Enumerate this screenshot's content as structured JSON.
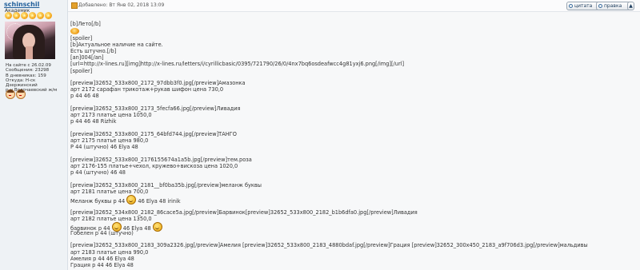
{
  "user": {
    "name": "schinschil",
    "rank": "Академик",
    "info": [
      "На сайте с 26.02.09",
      "Сообщения: 23298",
      "В дневниках: 159",
      "Откуда: Н-ск Дзержинский",
      "р-н Волочаевский ж/м"
    ],
    "star_icon": "sun-star-icon",
    "avatar_icon": "avatar-portrait"
  },
  "postbar": {
    "date": "Добавлено: Вт Янв 02, 2018 13:09",
    "quote_label": "цитата",
    "edit_label": "правка",
    "up_label": "▲"
  },
  "post_lines": {
    "l1": "[b]Лето[/b]",
    "l3": "[spoiler]",
    "l4": "[b]Актуальное наличие на сайте.",
    "l5": "Есть штучно.[/b]",
    "l6": "[an]004[/an]",
    "l7": "[url=http://x-lines.ru][img]http://x-lines.ru/letters/i/cyrillicbasic/0395/721790/26/0/4nx7bq6osdeafwcc4g81yxj6.png[/img][/url]",
    "l8": "[spoiler]",
    "b1a": "[preview]32652_533x800_2172_97dbb3f0.jpg[/preview]Амазонка",
    "b1b": "арт 2172 сарафан трикотаж+рукав шифон цена 730,0",
    "b1c": "р 44 46 48",
    "b2a": "[preview]32652_533x800_2173_5fecfa66.jpg[/preview]Ливадия",
    "b2b": "арт 2173 платье цена 1050,0",
    "b2c": "р 44 46 48 Rizhik",
    "b3a": "[preview]32652_533x800_2175_64bfd744.jpg[/preview]ТАНГО",
    "b3b": "арт 2175 платье цена 980,0",
    "b3c": "Р 44 (штучно) 46 Elya 48",
    "b4a": "[preview]32652_533x800_2176155674a1a5b.jpg[/preview]тем.роза",
    "b4b": "арт 2176-155 платье+чехол, кружево+вискоза цена 1020,0",
    "b4c": "р 44 (штучно) 46 48",
    "b5a": "[preview]32652_533x800_2181__bf0ba35b.jpg[/preview]меланж буквы",
    "b5b": "арт 2181 платье цена 700,0",
    "b5c1": "Меланж буквы р 44",
    "b5c2": "46 Elya 48 irinik",
    "b6a": "[preview]32652_534x800_2182_86cace5a.jpg[/preview]Барвинок[preview]32652_533x800_2182_b1b6dfa0.jpg[/preview]Ливадия",
    "b6b": "арт 2182 платье цена 1350,0",
    "b6c1": "барвинок р 44",
    "b6c2": "46 Elya 48",
    "b6d": "Гобелен р 44 (штучно)",
    "b7a": "[preview]32652_533x800_2183_309a2326.jpg[/preview]Амелия [preview]32652_533x800_2183_4880bdaf.jpg[/preview]Грация [preview]32652_300x450_2183_a9f706d3.jpg[/preview]мальдивы",
    "b7b": "арт 2183 платье цена 990,0",
    "b7c": "Амелия р 44 46 Elya 48",
    "b7d": "Грация р 44 46 Elya 48"
  }
}
